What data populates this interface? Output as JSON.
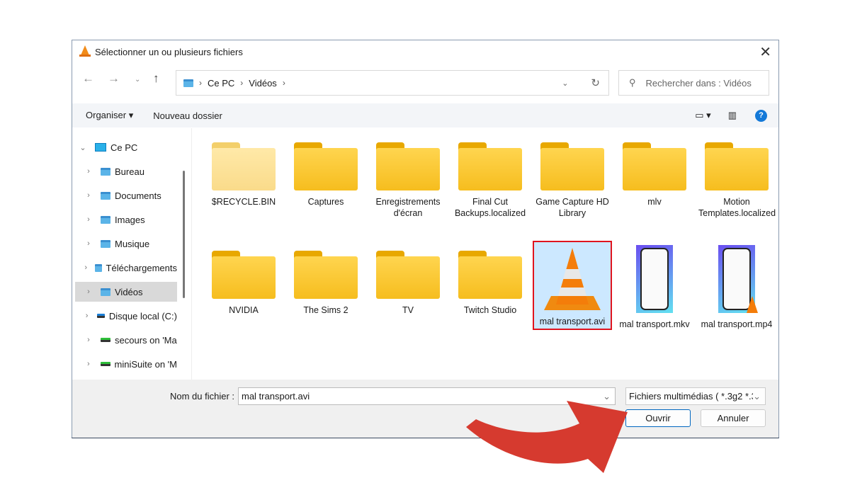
{
  "window": {
    "title": "Sélectionner un ou plusieurs fichiers",
    "icon": "vlc-cone-icon"
  },
  "nav": {
    "breadcrumb": [
      "Ce PC",
      "Vidéos"
    ],
    "search_placeholder": "Rechercher dans : Vidéos"
  },
  "toolbar": {
    "organize": "Organiser ▾",
    "new_folder": "Nouveau dossier"
  },
  "sidebar": {
    "root": "Ce PC",
    "items": [
      {
        "label": "Bureau",
        "icon": "desktop-folder-icon"
      },
      {
        "label": "Documents",
        "icon": "documents-folder-icon"
      },
      {
        "label": "Images",
        "icon": "images-folder-icon"
      },
      {
        "label": "Musique",
        "icon": "music-folder-icon"
      },
      {
        "label": "Téléchargements",
        "icon": "downloads-folder-icon"
      },
      {
        "label": "Vidéos",
        "icon": "videos-folder-icon",
        "selected": true
      },
      {
        "label": "Disque local (C:)",
        "icon": "drive-icon"
      },
      {
        "label": "secours on 'Ma",
        "icon": "network-drive-icon"
      },
      {
        "label": "miniSuite on 'M",
        "icon": "network-drive-icon"
      }
    ]
  },
  "files": [
    {
      "name": "$RECYCLE.BIN",
      "type": "folder-hidden"
    },
    {
      "name": "Captures",
      "type": "folder"
    },
    {
      "name": "Enregistrements d'écran",
      "type": "folder"
    },
    {
      "name": "Final Cut Backups.localized",
      "type": "folder"
    },
    {
      "name": "Game Capture HD Library",
      "type": "folder"
    },
    {
      "name": "mlv",
      "type": "folder"
    },
    {
      "name": "Motion Templates.localized",
      "type": "folder"
    },
    {
      "name": "NVIDIA",
      "type": "folder"
    },
    {
      "name": "The Sims 2",
      "type": "folder"
    },
    {
      "name": "TV",
      "type": "folder"
    },
    {
      "name": "Twitch Studio",
      "type": "folder"
    },
    {
      "name": "mal transport.avi",
      "type": "vlc",
      "selected": true
    },
    {
      "name": "mal transport.mkv",
      "type": "video-thumb"
    },
    {
      "name": "mal transport.mp4",
      "type": "video-thumb-vlc"
    }
  ],
  "footer": {
    "filename_label": "Nom du fichier :",
    "filename_value": "mal transport.avi",
    "filter": "Fichiers multimédias ( *.3g2 *.3",
    "open": "Ouvrir",
    "cancel": "Annuler"
  },
  "colors": {
    "selection": "#cce8ff",
    "highlight_border": "#e0141e",
    "arrow": "#d63a2f"
  }
}
